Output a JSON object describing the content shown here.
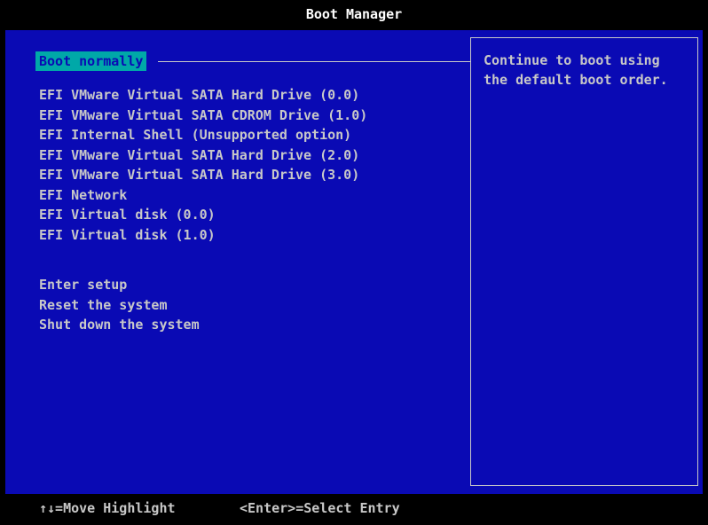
{
  "header": {
    "title": "Boot Manager"
  },
  "menu": {
    "selected": "Boot normally",
    "boot_devices": [
      "EFI VMware Virtual SATA Hard Drive (0.0)",
      "EFI VMware Virtual SATA CDROM Drive (1.0)",
      "EFI Internal Shell (Unsupported option)",
      "EFI VMware Virtual SATA Hard Drive (2.0)",
      "EFI VMware Virtual SATA Hard Drive (3.0)",
      "EFI Network",
      "EFI Virtual disk (0.0)",
      "EFI Virtual disk (1.0)"
    ],
    "system_actions": [
      "Enter setup",
      "Reset the system",
      "Shut down the system"
    ]
  },
  "help": {
    "text": "Continue to boot using the default boot order."
  },
  "footer": {
    "move_hint": "↑↓=Move Highlight",
    "select_hint": "<Enter>=Select Entry"
  },
  "colors": {
    "background_blue": "#0a0ab4",
    "highlight_cyan": "#00a8a8",
    "text_gray": "#c8c8c8",
    "title_white": "#ffffff",
    "bar_black": "#000000"
  }
}
